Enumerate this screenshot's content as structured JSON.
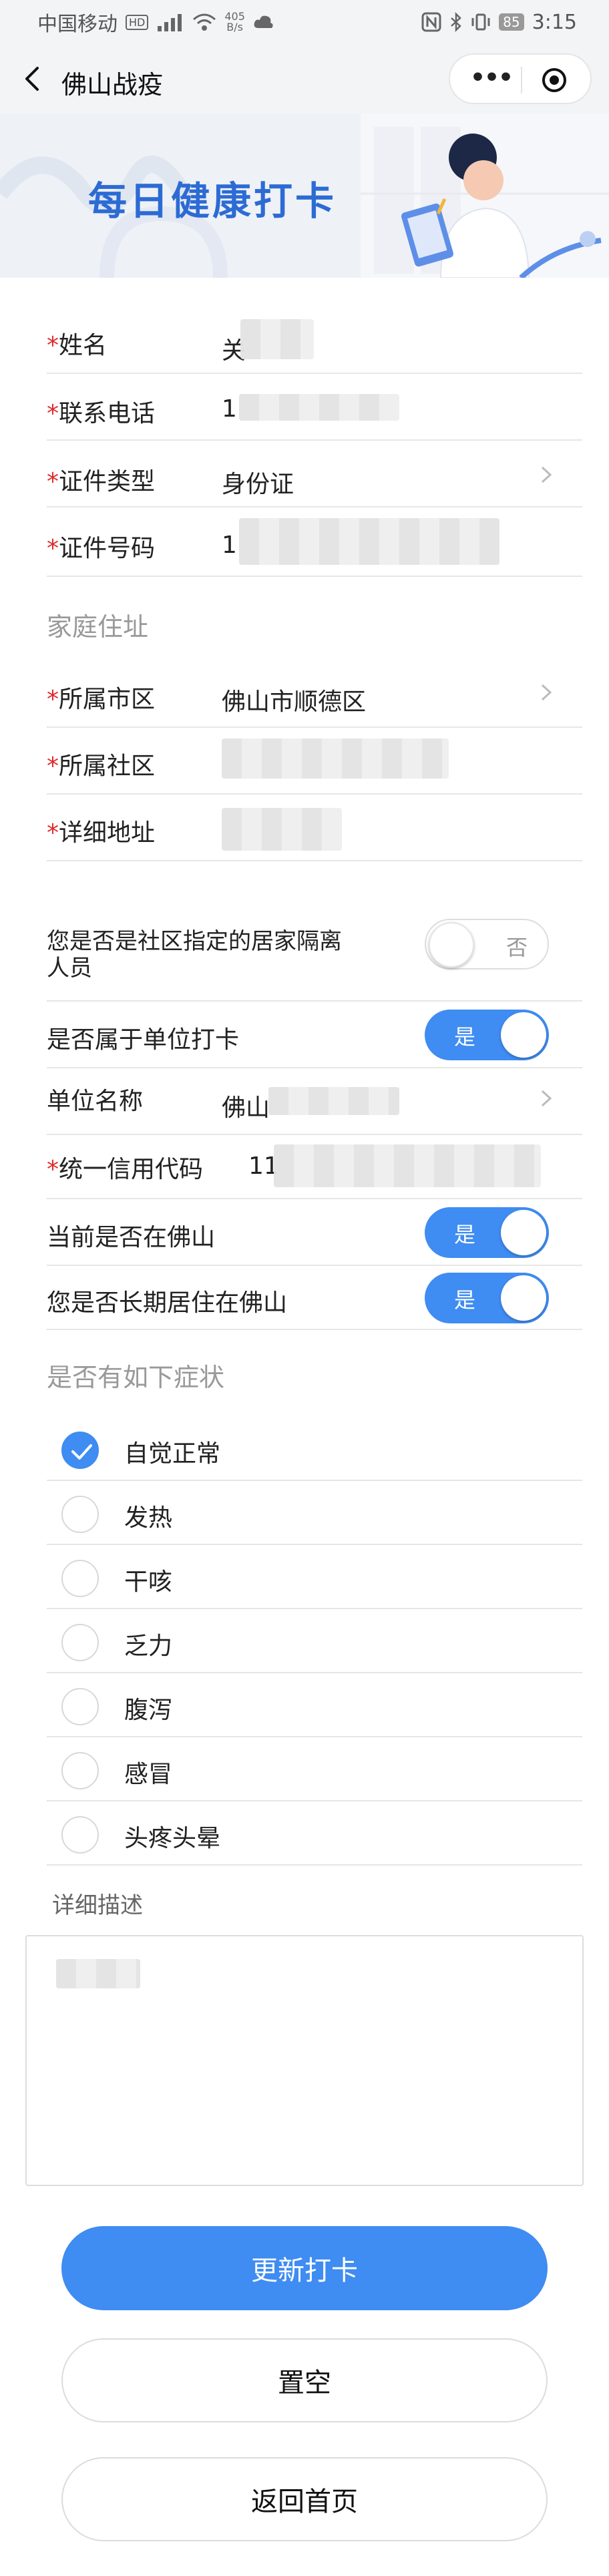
{
  "status_bar": {
    "carrier": "中国移动",
    "hd_badge": "HD",
    "signal": "⁴⁶",
    "speed_value": "405",
    "speed_unit": "B/s",
    "battery": "85",
    "time": "3:15"
  },
  "nav": {
    "title": "佛山战疫",
    "more_glyph": "•••"
  },
  "banner": {
    "title": "每日健康打卡"
  },
  "form": {
    "name": {
      "label": "姓名",
      "required": "*",
      "value_visible": "关"
    },
    "phone": {
      "label": "联系电话",
      "required": "*",
      "value_visible": "1"
    },
    "id_type": {
      "label": "证件类型",
      "required": "*",
      "value": "身份证"
    },
    "id_number": {
      "label": "证件号码",
      "required": "*",
      "value_visible": "1"
    },
    "home_section": "家庭住址",
    "city": {
      "label": "所属市区",
      "required": "*",
      "value": "佛山市顺德区"
    },
    "community": {
      "label": "所属社区",
      "required": "*"
    },
    "address": {
      "label": "详细地址",
      "required": "*"
    },
    "quarantine": {
      "label_line1": "您是否是社区指定的居家隔离",
      "label_line2": "人员",
      "state": "否"
    },
    "unit_checkin": {
      "label": "是否属于单位打卡",
      "state": "是"
    },
    "unit_name": {
      "label": "单位名称",
      "value_visible": "佛山"
    },
    "credit_code": {
      "label": "统一信用代码",
      "required": "*",
      "value_visible": "11"
    },
    "in_foshan": {
      "label": "当前是否在佛山",
      "state": "是"
    },
    "long_term": {
      "label": "您是否长期居住在佛山",
      "state": "是"
    }
  },
  "symptoms": {
    "title": "是否有如下症状",
    "items": [
      {
        "label": "自觉正常",
        "checked": true
      },
      {
        "label": "发热",
        "checked": false
      },
      {
        "label": "干咳",
        "checked": false
      },
      {
        "label": "乏力",
        "checked": false
      },
      {
        "label": "腹泻",
        "checked": false
      },
      {
        "label": "感冒",
        "checked": false
      },
      {
        "label": "头疼头晕",
        "checked": false
      }
    ]
  },
  "description": {
    "label": "详细描述"
  },
  "buttons": {
    "update": "更新打卡",
    "clear": "置空",
    "home": "返回首页"
  },
  "colors": {
    "accent": "#3f8cf2",
    "required": "#e02a2a",
    "banner_title": "#2c6bd4"
  }
}
